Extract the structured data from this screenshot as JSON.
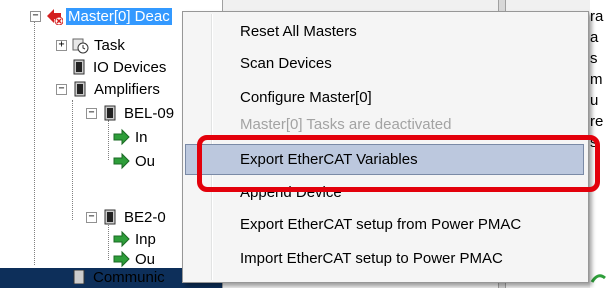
{
  "tree": {
    "items": [
      {
        "label": "Master[0] Deac",
        "expander": "−"
      },
      {
        "label": "Task",
        "expander": "+"
      },
      {
        "label": "IO Devices",
        "expander": ""
      },
      {
        "label": "Amplifiers",
        "expander": "−"
      },
      {
        "label": "BEL-09",
        "expander": "−"
      },
      {
        "label": "In",
        "expander": ""
      },
      {
        "label": "Ou",
        "expander": ""
      },
      {
        "label": "BE2-0",
        "expander": "−"
      },
      {
        "label": "Inp",
        "expander": ""
      },
      {
        "label": "Ou",
        "expander": ""
      },
      {
        "label": "Communic",
        "expander": ""
      }
    ]
  },
  "right_panel": {
    "partial_text": [
      "ra",
      "a",
      "s",
      "m",
      "u",
      "re",
      "s"
    ]
  },
  "context_menu": {
    "items": [
      {
        "label": "Reset All Masters",
        "state": "normal"
      },
      {
        "label": "Scan Devices",
        "state": "normal"
      },
      {
        "label": "Configure Master[0]",
        "state": "normal"
      },
      {
        "label": "Master[0] Tasks are deactivated",
        "state": "disabled"
      },
      {
        "label": "Export EtherCAT Variables",
        "state": "highlighted"
      },
      {
        "label": "Append Device",
        "state": "normal"
      },
      {
        "label": "Export EtherCAT setup from Power PMAC",
        "state": "normal"
      },
      {
        "label": "Import EtherCAT setup to Power PMAC",
        "state": "normal"
      }
    ]
  },
  "colors": {
    "highlight_bg": "#bcc8de",
    "annotation_red": "#e3000b",
    "selection_blue": "#3399ff"
  }
}
